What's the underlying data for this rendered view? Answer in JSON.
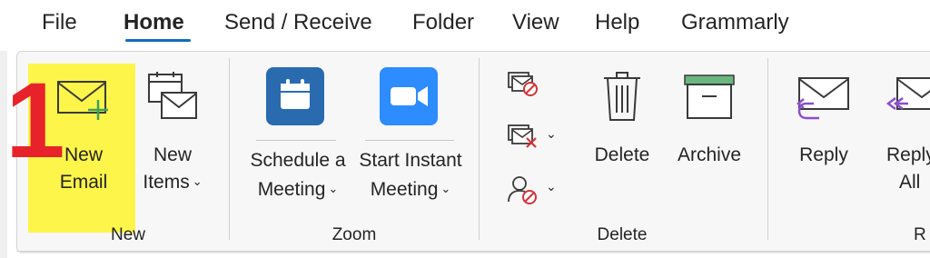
{
  "menu": {
    "tabs": [
      "File",
      "Home",
      "Send / Receive",
      "Folder",
      "View",
      "Help",
      "Grammarly"
    ]
  },
  "annotation": {
    "step": "1"
  },
  "ribbon": {
    "new_group": {
      "label": "New",
      "new_email": {
        "line1": "New",
        "line2": "Email",
        "icon": "envelope-plus-icon"
      },
      "new_items": {
        "line1": "New",
        "line2": "Items",
        "icon": "new-items-icon",
        "chevron": "⌄"
      }
    },
    "zoom_group": {
      "label": "Zoom",
      "schedule": {
        "line1": "Schedule a",
        "line2": "Meeting",
        "icon": "calendar-icon",
        "chevron": "⌄"
      },
      "start": {
        "line1": "Start Instant",
        "line2": "Meeting",
        "icon": "video-camera-icon",
        "chevron": "⌄"
      }
    },
    "delete_group": {
      "label": "Delete",
      "ignore": {
        "icon": "ignore-conversation-icon"
      },
      "cleanup": {
        "icon": "clean-up-icon",
        "chevron": "⌄"
      },
      "junk": {
        "icon": "block-sender-icon",
        "chevron": "⌄"
      },
      "delete": {
        "label": "Delete",
        "icon": "trash-icon"
      },
      "archive": {
        "label": "Archive",
        "icon": "archive-box-icon"
      }
    },
    "respond_group": {
      "label": "R",
      "reply": {
        "label": "Reply",
        "icon": "reply-icon"
      },
      "reply_all": {
        "line1": "Reply",
        "line2": "All",
        "icon": "reply-all-icon"
      }
    }
  },
  "colors": {
    "accent": "#0f6cbd",
    "highlight": "#fdf54a",
    "annotation_red": "#e8222a",
    "zoom_blue": "#2d8cff",
    "calendar_blue": "#2a6bb0",
    "archive_green": "#6ab77e",
    "reply_purple": "#8a4fc9",
    "delete_red": "#d13438"
  }
}
